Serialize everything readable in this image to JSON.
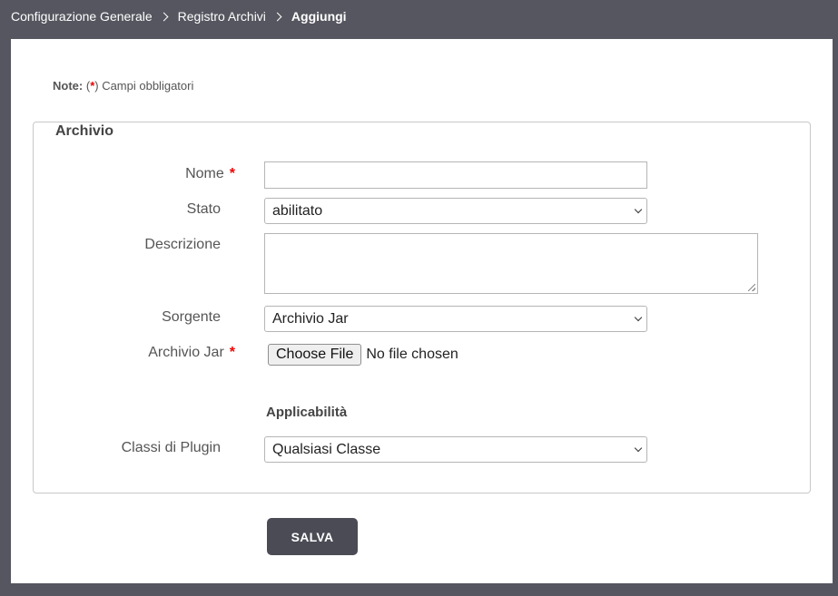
{
  "breadcrumb": {
    "items": [
      "Configurazione Generale",
      "Registro Archivi"
    ],
    "current": "Aggiungi"
  },
  "note": {
    "label": "Note:",
    "open": "(",
    "star": "*",
    "text": ") Campi obbligatori"
  },
  "fieldset": {
    "legend": "Archivio"
  },
  "form": {
    "nome": {
      "label": "Nome",
      "required_mark": "*",
      "value": ""
    },
    "stato": {
      "label": "Stato",
      "selected": "abilitato"
    },
    "descrizione": {
      "label": "Descrizione",
      "value": ""
    },
    "sorgente": {
      "label": "Sorgente",
      "selected": "Archivio Jar"
    },
    "archivio_jar": {
      "label": "Archivio Jar",
      "required_mark": "*",
      "button_label": "Choose File",
      "status": "No file chosen"
    },
    "applicabilita": {
      "title": "Applicabilità"
    },
    "classi_plugin": {
      "label": "Classi di Plugin",
      "selected": "Qualsiasi Classe"
    }
  },
  "actions": {
    "save_label": "SALVA"
  },
  "colors": {
    "header_bg": "#55565f",
    "required": "#ee0000",
    "button_bg": "#4a4b55"
  }
}
